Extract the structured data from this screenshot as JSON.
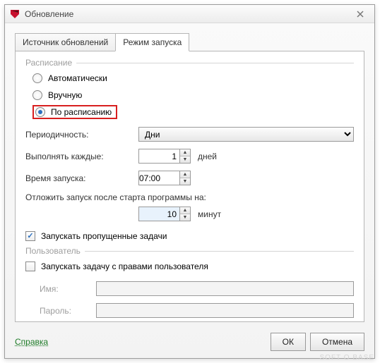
{
  "window": {
    "title": "Обновление"
  },
  "tabs": {
    "inactive": "Источник обновлений",
    "active": "Режим запуска"
  },
  "schedule_group": "Расписание",
  "radio": {
    "auto": "Автоматически",
    "manual": "Вручную",
    "sched": "По расписанию"
  },
  "periodicity": {
    "label": "Периодичность:",
    "value": "Дни"
  },
  "every": {
    "label": "Выполнять каждые:",
    "value": "1",
    "units": "дней"
  },
  "time": {
    "label": "Время запуска:",
    "value": "07:00"
  },
  "delay": {
    "label": "Отложить запуск после старта программы на:",
    "value": "10",
    "units": "минут"
  },
  "run_missed": "Запускать пропущенные задачи",
  "user_group": "Пользователь",
  "run_as": "Запускать задачу с правами пользователя",
  "name_label": "Имя:",
  "pass_label": "Пароль:",
  "help": "Справка",
  "ok": "ОК",
  "cancel": "Отмена",
  "watermark": "SOFT O BASE"
}
